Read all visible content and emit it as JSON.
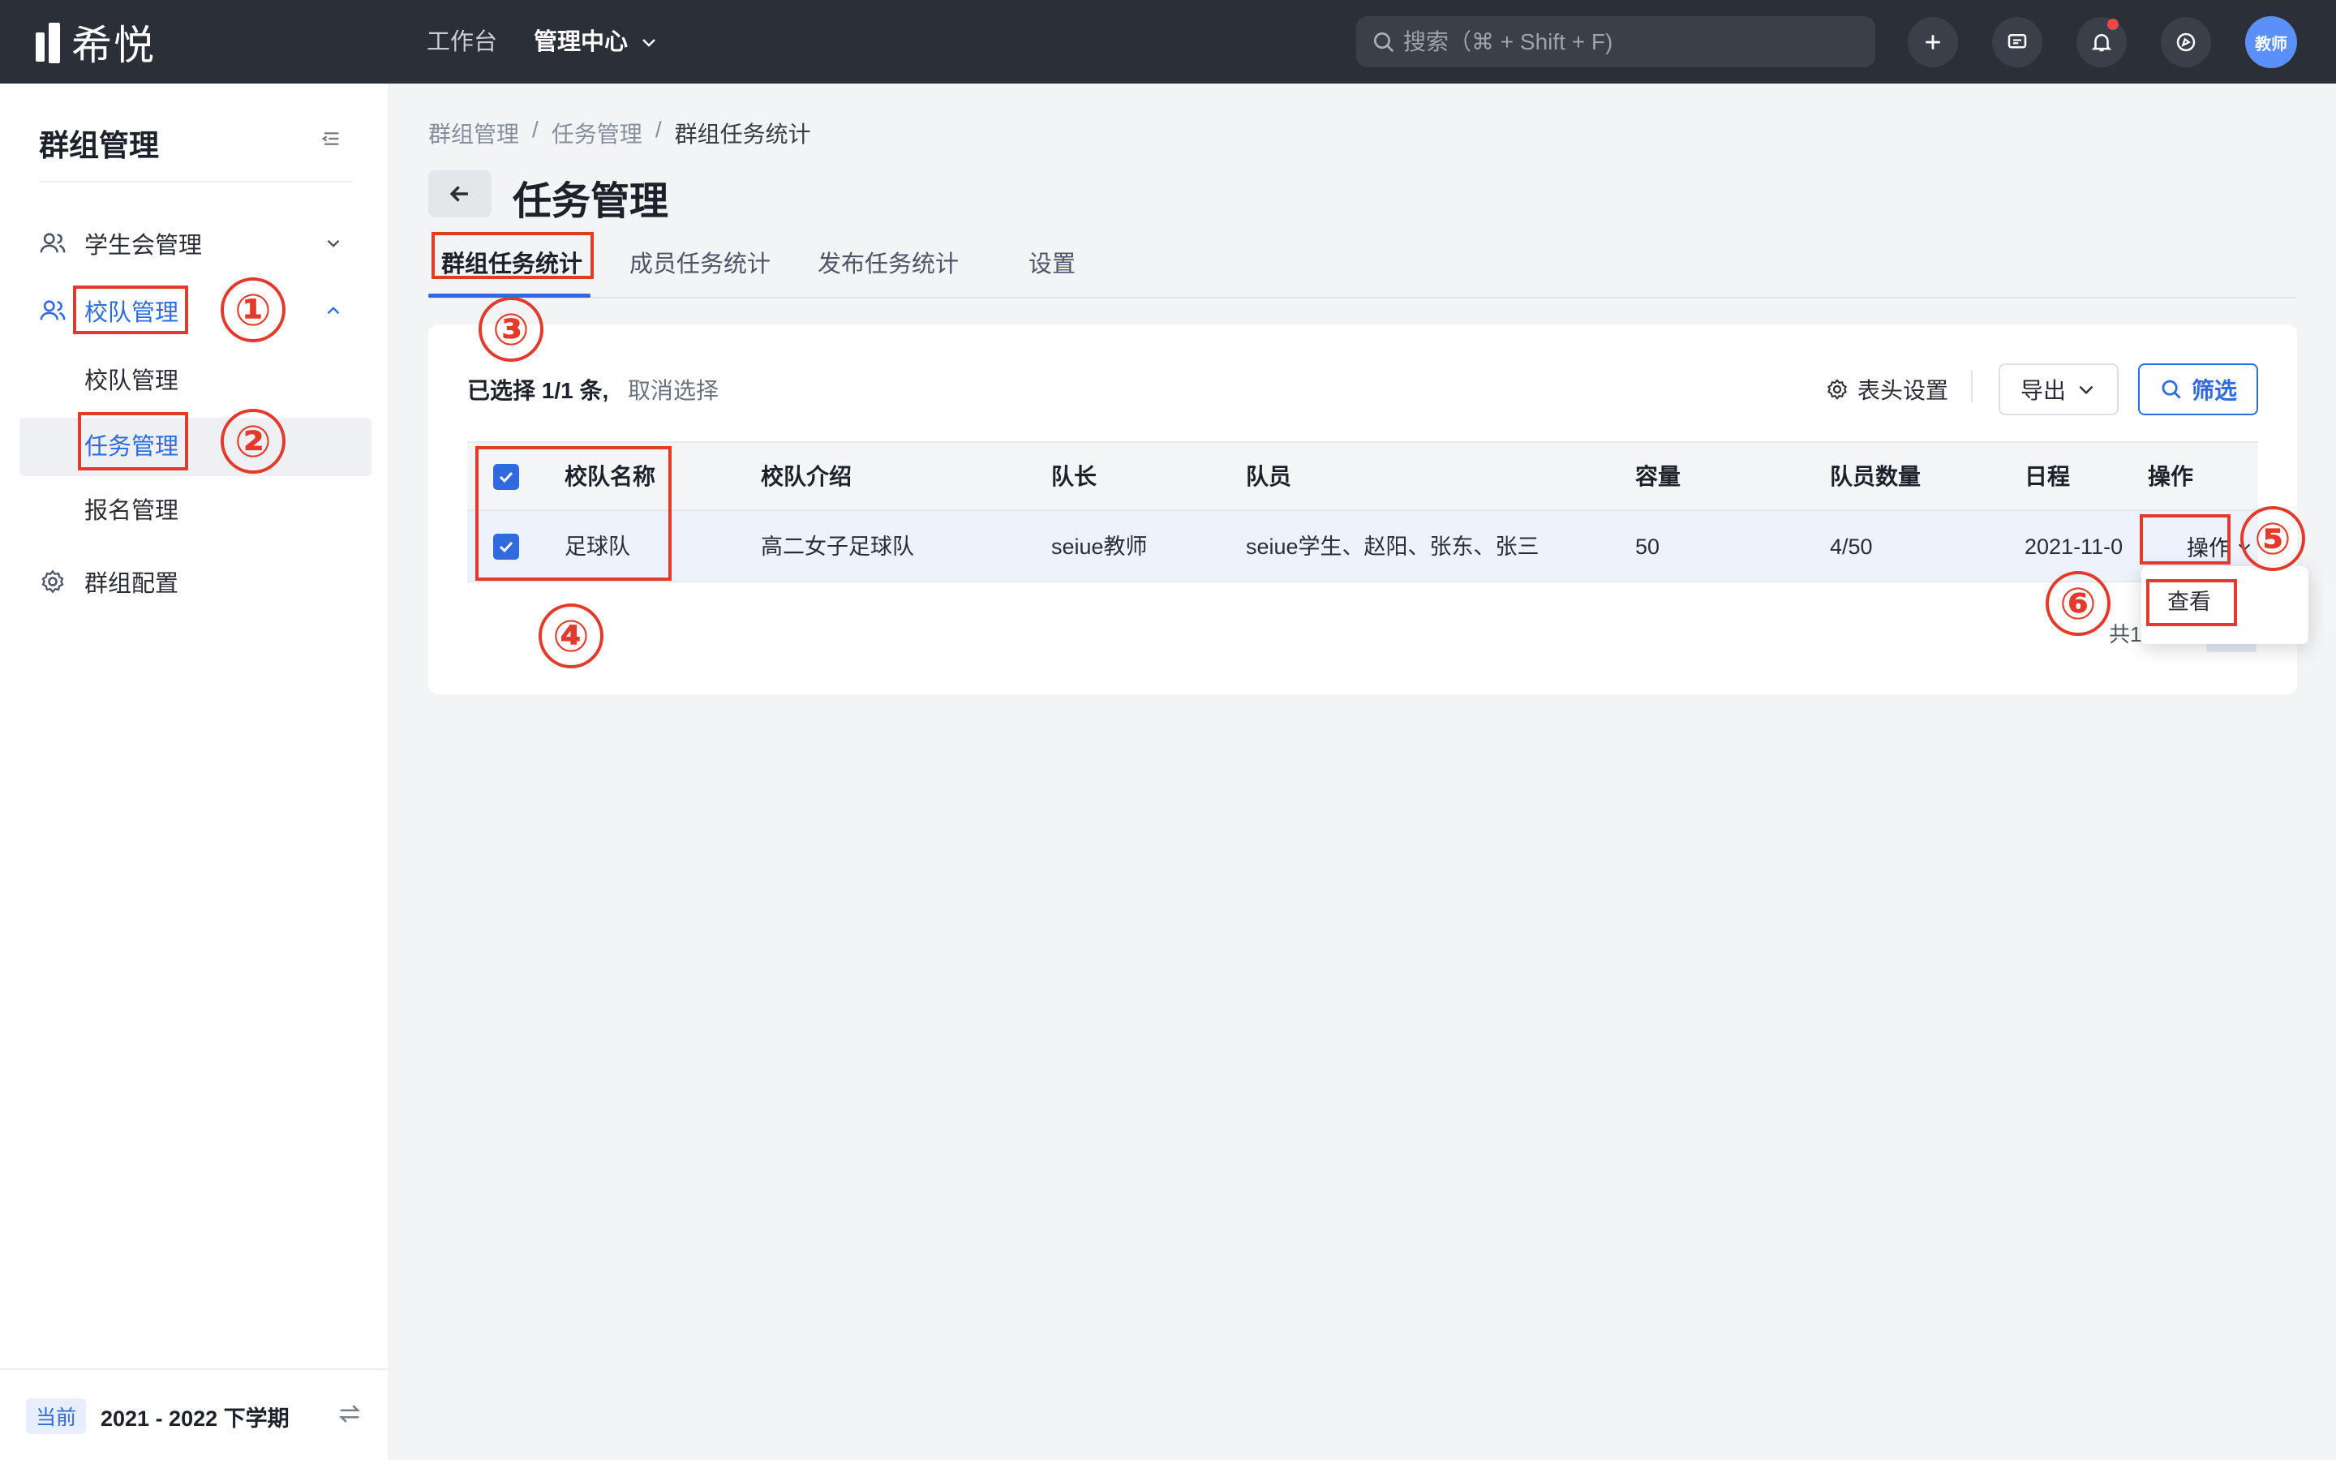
{
  "topbar": {
    "logo_text": "希悦",
    "nav": [
      {
        "label": "工作台"
      },
      {
        "label": "管理中心"
      }
    ],
    "search_placeholder": "搜索（⌘ + Shift + F)",
    "avatar_text": "教师"
  },
  "sidebar": {
    "title": "群组管理",
    "items": [
      {
        "label": "学生会管理",
        "icon": "users-icon"
      },
      {
        "label": "校队管理",
        "icon": "users-icon"
      },
      {
        "label": "群组配置",
        "icon": "gear-icon"
      }
    ],
    "sub_items": [
      {
        "label": "校队管理"
      },
      {
        "label": "任务管理"
      },
      {
        "label": "报名管理"
      }
    ],
    "term_badge": "当前",
    "term_text": "2021 - 2022 下学期"
  },
  "main": {
    "breadcrumb": [
      "群组管理",
      "/",
      "任务管理",
      "/",
      "群组任务统计"
    ],
    "page_title": "任务管理",
    "tabs": [
      {
        "label": "群组任务统计"
      },
      {
        "label": "成员任务统计"
      },
      {
        "label": "发布任务统计"
      },
      {
        "label": "设置"
      }
    ],
    "selection_info": "已选择 1/1 条,",
    "cancel_selection": "取消选择",
    "header_setting": "表头设置",
    "export_label": "导出",
    "filter_label": "筛选",
    "table": {
      "columns": [
        "校队名称",
        "校队介绍",
        "队长",
        "队员",
        "容量",
        "队员数量",
        "日程",
        "操作"
      ],
      "rows": [
        [
          "足球队",
          "高二女子足球队",
          "seiue教师",
          "seiue学生、赵阳、张东、张三",
          "50",
          "4/50",
          "2021-11-0"
        ]
      ],
      "row_action": "操作"
    },
    "dropdown_item": "查看",
    "total_text": "共1"
  },
  "annotations": [
    "①",
    "②",
    "③",
    "④",
    "⑤",
    "⑥"
  ],
  "colors": {
    "topbar": "#2b2f38",
    "accent": "#2f6bde",
    "annotation": "#e23b2b"
  }
}
